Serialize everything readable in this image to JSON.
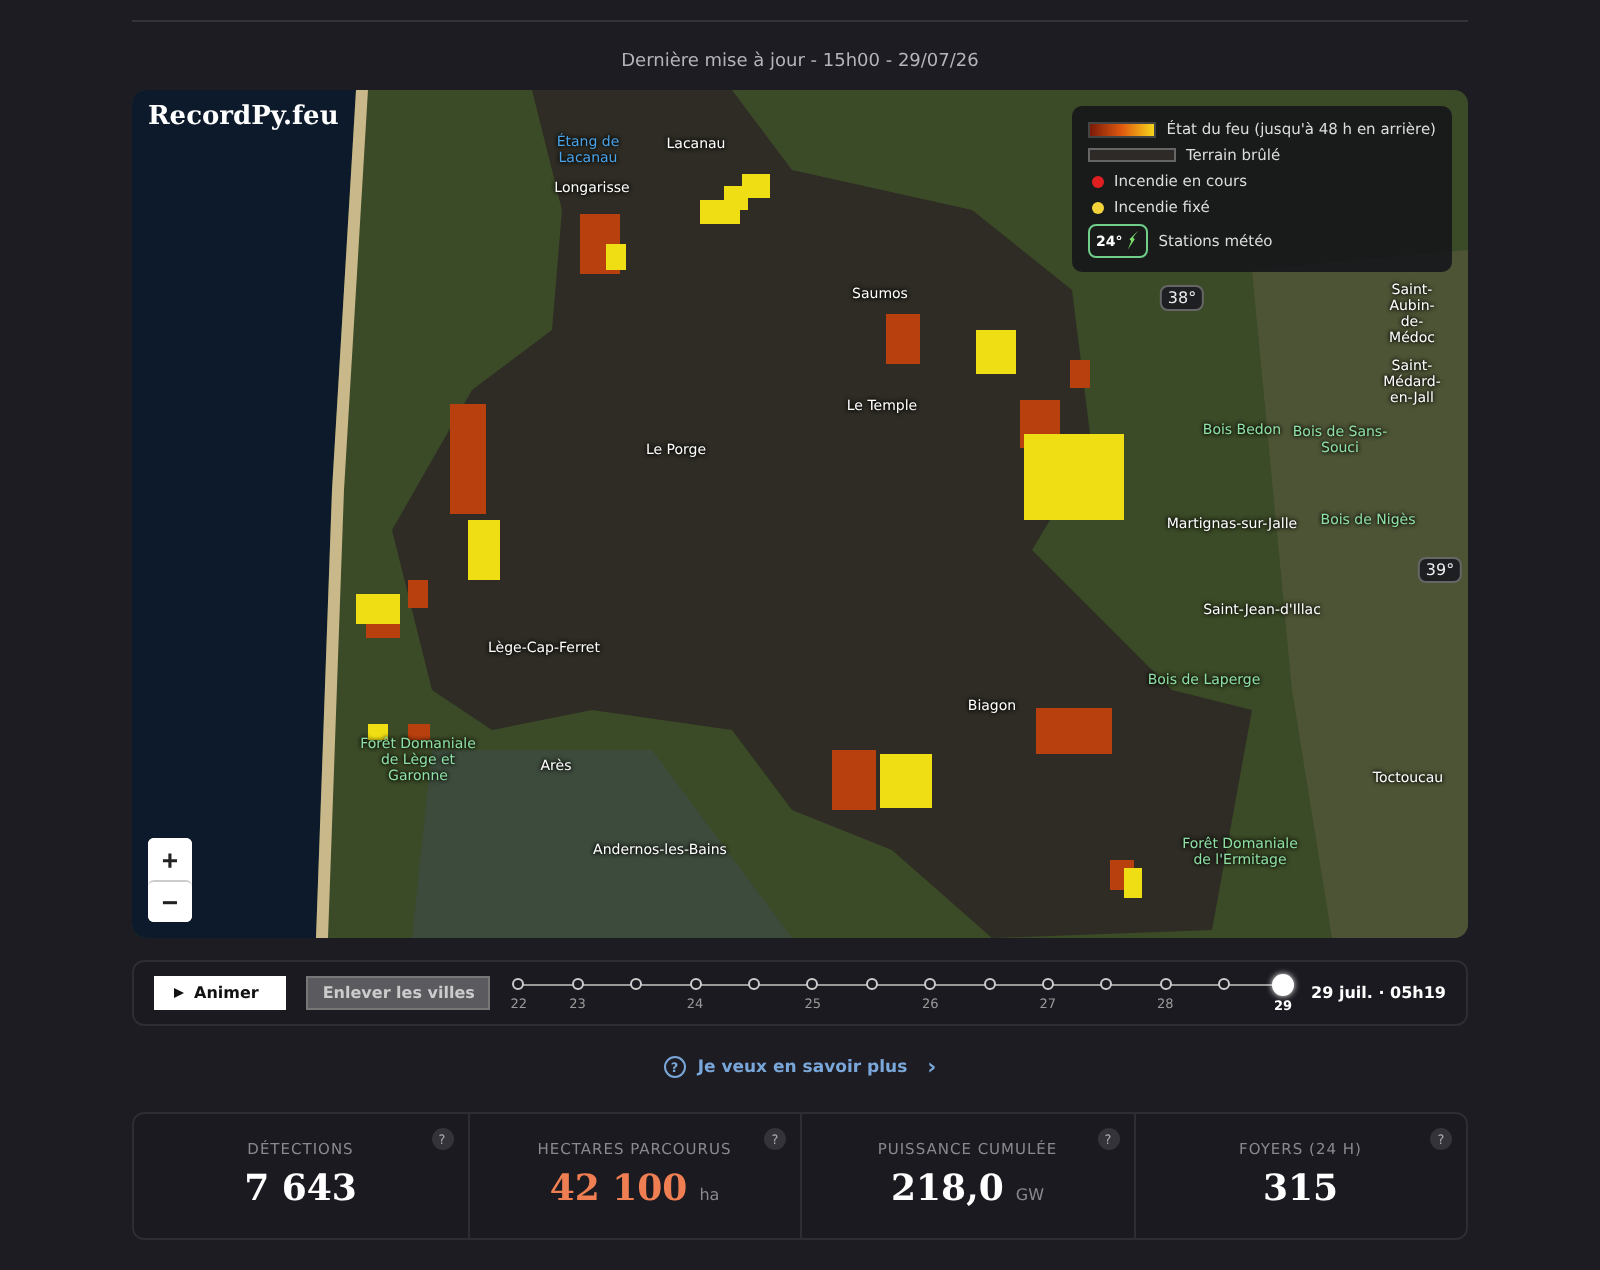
{
  "updated": "Dernière mise à jour - 15h00 - 29/07/26",
  "map": {
    "brand": "RecordPy.feu",
    "zoom": [
      "+",
      "−"
    ],
    "legend": [
      {
        "kind": "gradient",
        "label": "État du feu (jusqu'à 48 h en arrière)"
      },
      {
        "kind": "burned",
        "label": "Terrain brûlé"
      },
      {
        "kind": "dot",
        "color": "#e02020",
        "label": "Incendie en cours"
      },
      {
        "kind": "dot",
        "color": "#f2d43a",
        "label": "Incendie fixé"
      },
      {
        "kind": "station",
        "badge": "24°",
        "label": "Stations météo"
      }
    ],
    "places": [
      {
        "kind": "water",
        "name": "Étang de Lacanau"
      },
      {
        "kind": "town",
        "name": "Lacanau"
      },
      {
        "kind": "town",
        "name": "Longarisse"
      },
      {
        "kind": "town",
        "name": "Saumos"
      },
      {
        "kind": "town",
        "name": "Le Temple"
      },
      {
        "kind": "town",
        "name": "Le Porge"
      },
      {
        "kind": "town",
        "name": "Saint-Aubin-de-Médoc"
      },
      {
        "kind": "town",
        "name": "Saint-Médard-en-Jall"
      },
      {
        "kind": "wood",
        "name": "Bois Bedon"
      },
      {
        "kind": "wood",
        "name": "Bois de Sans-Souci"
      },
      {
        "kind": "town",
        "name": "Martignas-sur-Jalle"
      },
      {
        "kind": "wood",
        "name": "Bois de Nigès"
      },
      {
        "kind": "town",
        "name": "Saint-Jean-d'Illac"
      },
      {
        "kind": "town",
        "name": "Lège-Cap-Ferret"
      },
      {
        "kind": "wood",
        "name": "Bois de Laperge"
      },
      {
        "kind": "town",
        "name": "Biagon"
      },
      {
        "kind": "wood",
        "name": "Forêt Domaniale de Lège et Garonne"
      },
      {
        "kind": "town",
        "name": "Arès"
      },
      {
        "kind": "town",
        "name": "Andernos-les-Bains"
      },
      {
        "kind": "town",
        "name": "Toctoucau"
      },
      {
        "kind": "wood",
        "name": "Forêt Domaniale de l'Ermitage"
      }
    ],
    "stations": [
      "38°",
      "39°"
    ]
  },
  "controls": {
    "animate": "Animer",
    "cities": "Enlever les villes",
    "current": "29 juil. · 05h19",
    "ticks": [
      {
        "label": "22",
        "selected": false
      },
      {
        "label": "23",
        "selected": false
      },
      {
        "selected": false
      },
      {
        "label": "24",
        "selected": false
      },
      {
        "selected": false
      },
      {
        "label": "25",
        "selected": false
      },
      {
        "selected": false
      },
      {
        "label": "26",
        "selected": false
      },
      {
        "selected": false
      },
      {
        "label": "27",
        "selected": false
      },
      {
        "selected": false
      },
      {
        "label": "28",
        "selected": false
      },
      {
        "selected": false
      },
      {
        "label": "29",
        "selected": true
      }
    ]
  },
  "more_link": {
    "icon": "?",
    "label": "Je veux en savoir plus",
    "arrow": "›"
  },
  "stats": [
    {
      "label": "DÉTECTIONS",
      "value": "7 643",
      "help": "?",
      "accent": false
    },
    {
      "label": "HECTARES PARCOURUS",
      "value": "42 100",
      "unit": "ha",
      "help": "?",
      "accent": true
    },
    {
      "label": "PUISSANCE CUMULÉE",
      "value": "218,0",
      "unit": "GW",
      "help": "?",
      "accent": false
    },
    {
      "label": "FOYERS (24 H)",
      "value": "315",
      "help": "?",
      "accent": false
    }
  ]
}
